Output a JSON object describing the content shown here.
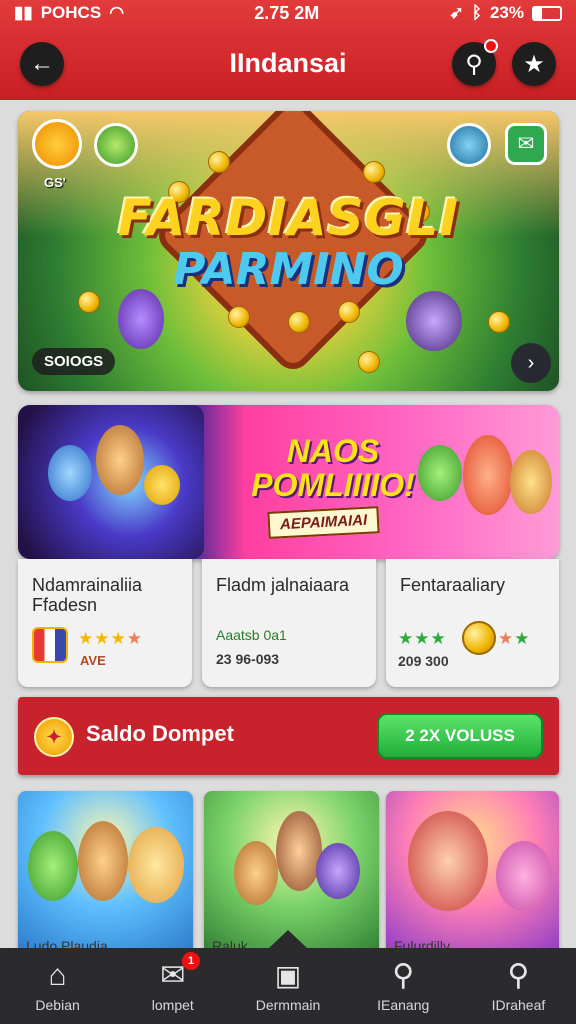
{
  "status_bar": {
    "carrier": "POHCS",
    "time": "2.75 2M",
    "battery": "23%"
  },
  "header": {
    "title": "IIndansai"
  },
  "hero": {
    "title_line1": "FARDIASGLI",
    "title_line2": "PARMINO",
    "badge_label": "GS'",
    "chip_label": "SOIOGS"
  },
  "promo": {
    "title_line1": "NAOS",
    "title_line2": "POMLIIIIO!",
    "tag": "AEPAIMAIAI"
  },
  "cards": [
    {
      "name": "Ndamrainaliia Ffadesn",
      "rating": 3,
      "rating_max": 4,
      "value": "AVE"
    },
    {
      "name": "Fladm jalnaiaara",
      "subtitle": "Aaatsb 0a1",
      "value": "23 96-093"
    },
    {
      "name": "Fentaraaliary",
      "rating": 3,
      "rating_max": 5,
      "value": "209 300"
    }
  ],
  "saldo": {
    "label": "Saldo Dompet",
    "button_label": "2 2X VOLUSS"
  },
  "thumbnails": [
    {
      "label": "Ludo Plaudia"
    },
    {
      "label": "Raluk"
    },
    {
      "label": "Fulurdilly"
    }
  ],
  "bottom_nav": [
    {
      "label": "Debian",
      "icon": "home-icon"
    },
    {
      "label": "lompet",
      "icon": "gift-icon",
      "badge": "1"
    },
    {
      "label": "Dermmain",
      "icon": "chest-icon"
    },
    {
      "label": "IEanang",
      "icon": "search-icon"
    },
    {
      "label": "IDraheaf",
      "icon": "search-icon"
    }
  ],
  "colors": {
    "header_red": "#c81f24",
    "saldo_red": "#c8232c",
    "button_green": "#1fae3a",
    "nav_dark": "#2b2b2d"
  }
}
